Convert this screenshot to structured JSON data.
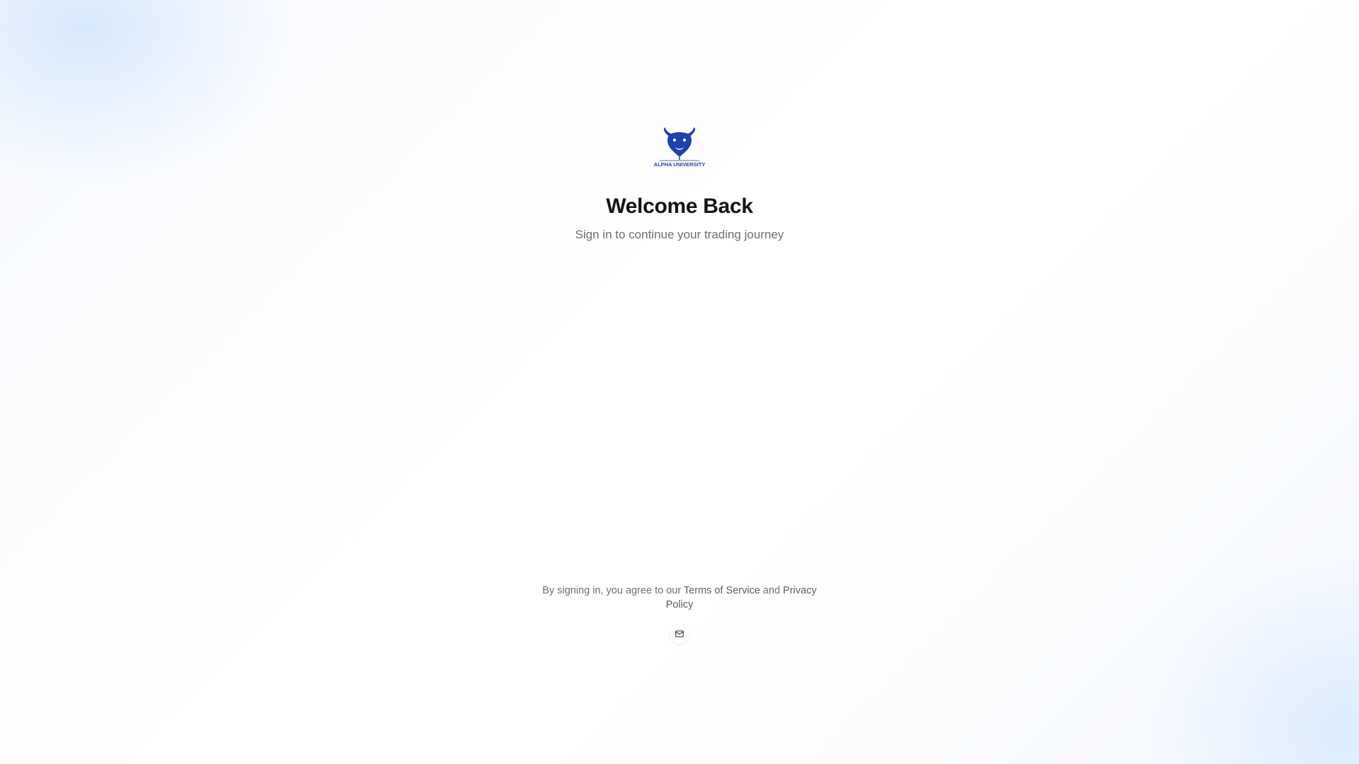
{
  "logo": {
    "text": "ALPHA UNIVERSITY",
    "color": "#1e3fae"
  },
  "header": {
    "title": "Welcome Back",
    "subtitle": "Sign in to continue your trading journey"
  },
  "legal": {
    "prefix": "By signing in, you agree to our ",
    "terms_label": "Terms of Service",
    "middle": " and ",
    "privacy_label": "Privacy Policy"
  },
  "contact": {
    "icon": "mail-icon"
  }
}
